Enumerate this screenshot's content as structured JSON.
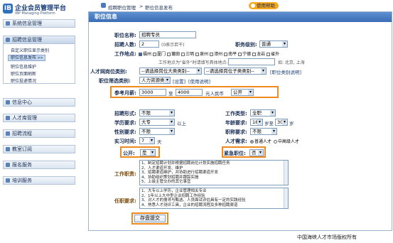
{
  "logo": {
    "mark": "IB",
    "title": "企业会员管理平台",
    "subtitle": "IBP Managing Platform"
  },
  "menu": [
    {
      "label": "系统信息管理"
    },
    {
      "label": "招聘信息管理"
    },
    {
      "label": "信息中心"
    },
    {
      "label": "人才库管理"
    },
    {
      "label": "招聘流程"
    },
    {
      "label": "教室订阅"
    },
    {
      "label": "报名服务"
    },
    {
      "label": "培训服务"
    }
  ],
  "submenu": [
    "自定义职位显示类别",
    "职位信息发布 »»",
    "职位信息维护",
    "职位页面刷新",
    "职位投递情况"
  ],
  "breadcrumb": {
    "a": "招聘职位管理",
    "sep": ">",
    "b": "职位信息发布",
    "help": "使用帮助"
  },
  "panel_title": "职位信息",
  "form": {
    "job_name_label": "职位名称:",
    "job_name_value": "招聘专员",
    "count_label": "招聘人数:",
    "count_value": "2",
    "count_note": "(0表示若干)",
    "level_label": "职务级别:",
    "level_value": "普通",
    "location_label": "工作地点:",
    "locations": [
      {
        "label": "福州",
        "on": true
      },
      {
        "label": "厦门",
        "on": false
      },
      {
        "label": "莆田",
        "on": false
      },
      {
        "label": "三明",
        "on": false
      },
      {
        "label": "泉州",
        "on": false
      },
      {
        "label": "漳州",
        "on": false
      },
      {
        "label": "南平",
        "on": false
      },
      {
        "label": "宁德",
        "on": false
      },
      {
        "label": "龙岩",
        "on": false
      },
      {
        "label": "省外",
        "on": false
      }
    ],
    "location_note": "工作地点为\"省外\"时请填写具体地点:",
    "location_example": "如: 北京, 上海",
    "category_label": "人才网岗位类别:",
    "category_main": "--请选择岗位大类类别--",
    "category_sub": "--请选择岗位子类类别--",
    "category_tip": "[职位类别说明]",
    "jobcat_label": "职位筛选类别:",
    "jobcat_value": "人力资源类",
    "jobcat_set": "[设置]",
    "jobcat_help": "[使用说明]",
    "salary_label": "参考月薪:",
    "salary_from": "3000",
    "salary_to_word": "至",
    "salary_to": "4000",
    "salary_unit": "元人民币",
    "salary_open": "公开",
    "type_label": "招聘形式:",
    "type_value": "不限",
    "worktype_label": "工作类型:",
    "worktype_value": "全职",
    "edu_label": "学历要求:",
    "edu_value": "大专",
    "edu_suffix": "以上",
    "age_label": "年龄要求:",
    "age_from": "18",
    "age_to_word": "岁至",
    "age_to": "30",
    "age_unit": "岁",
    "sex_label": "性别要求:",
    "sex_value": "不限",
    "title_label": "职称要求:",
    "title_value": "不限",
    "exp_label": "实习时间:",
    "exp_value": "7",
    "exp_unit": "天",
    "talent_label": "人才需求:",
    "talent_opt1": "普通人才",
    "talent_opt2": "中高级人才",
    "public_label": "公开:",
    "public_value": "是",
    "urgent_label": "紧急职位:",
    "urgent_value": "否",
    "duty_label": "工作职责:",
    "duty_lines": [
      "1、制定招聘计划并根据招聘岗位计划实施招聘任务",
      "2、人才渠道开发、维护",
      "3、招聘渠道维护，并协助进行招聘渠道开发",
      "4、协助组织策划招聘并跟踪实施",
      "5、上级主管交办的其它事宜"
    ],
    "req_label": "任职要求:",
    "req_lines": [
      "1、大专以上学历，企业管理相关专业",
      "2、1年以上大中型企业招聘工作经验",
      "3、对人才的搜寻与甄选、人员面试评估具有一定的实践经验",
      "4、熟悉人才测评工具，企业的招聘流程及多种招聘渠道"
    ],
    "save_label": "存盘提交"
  },
  "footer": "中国海峡人才市场版权所有",
  "colors": {
    "highlight": "#f08a1e",
    "header": "#3b6db5",
    "help": "#f6a81f"
  }
}
